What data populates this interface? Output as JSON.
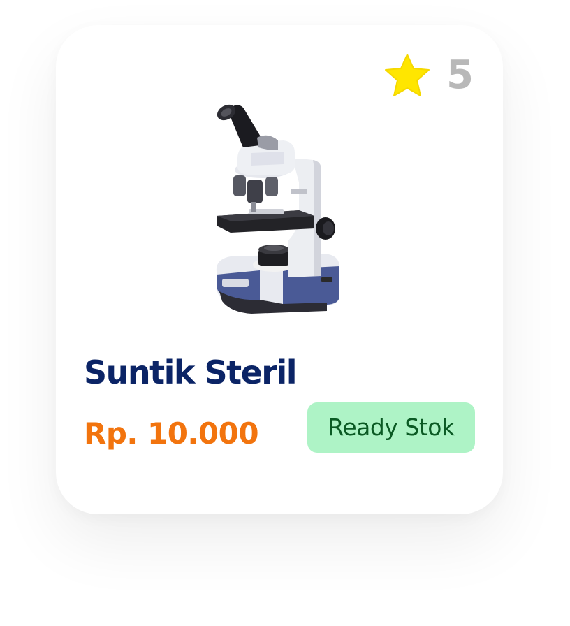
{
  "product": {
    "name": "Suntik Steril",
    "price": "Rp. 10.000",
    "stock_status": "Ready Stok",
    "rating": "5",
    "image_icon": "microscope-image"
  },
  "colors": {
    "title": "#0b2466",
    "price": "#f2740e",
    "badge_bg": "#aef3c6",
    "badge_text": "#0b5a24",
    "star": "#ffe600",
    "rating_text": "#b8b8b8"
  }
}
